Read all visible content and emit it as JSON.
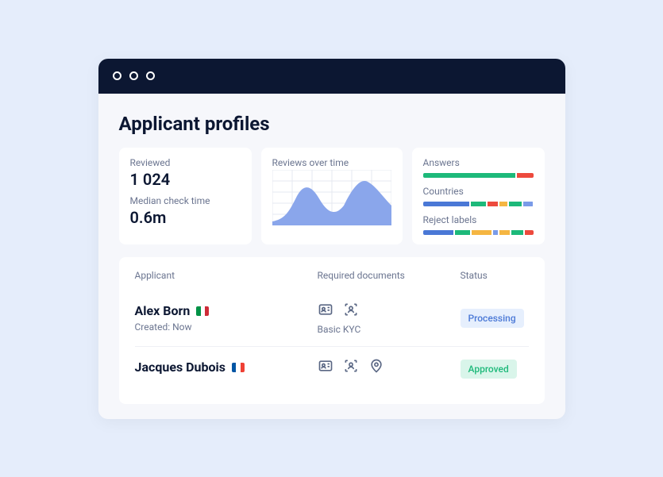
{
  "page_title": "Applicant profiles",
  "stats": {
    "reviewed_label": "Reviewed",
    "reviewed_value": "1 024",
    "median_label": "Median check time",
    "median_value": "0.6m"
  },
  "chart_title": "Reviews over time",
  "chart_data": {
    "type": "area",
    "title": "Reviews over time",
    "xlabel": "",
    "ylabel": "",
    "x": [
      0,
      1,
      2,
      3,
      4,
      5,
      6,
      7,
      8,
      9
    ],
    "values": [
      5,
      10,
      35,
      50,
      30,
      15,
      25,
      55,
      50,
      30
    ]
  },
  "bars": {
    "answers_label": "Answers",
    "answers_segments": [
      {
        "color": "#1db97a",
        "pct": 85
      },
      {
        "color": "#ed4a3d",
        "pct": 15
      }
    ],
    "countries_label": "Countries",
    "countries_segments": [
      {
        "color": "#4a78d6",
        "pct": 45
      },
      {
        "color": "#1db97a",
        "pct": 15
      },
      {
        "color": "#ed4a3d",
        "pct": 10
      },
      {
        "color": "#f5b642",
        "pct": 8
      },
      {
        "color": "#1db97a",
        "pct": 12
      },
      {
        "color": "#7a9be8",
        "pct": 10
      }
    ],
    "reject_label": "Reject labels",
    "reject_segments": [
      {
        "color": "#4a78d6",
        "pct": 30
      },
      {
        "color": "#1db97a",
        "pct": 15
      },
      {
        "color": "#f5b642",
        "pct": 20
      },
      {
        "color": "#7a9be8",
        "pct": 5
      },
      {
        "color": "#f5b642",
        "pct": 10
      },
      {
        "color": "#1db97a",
        "pct": 12
      },
      {
        "color": "#ed4a3d",
        "pct": 8
      }
    ]
  },
  "table": {
    "headers": {
      "applicant": "Applicant",
      "docs": "Required documents",
      "status": "Status"
    },
    "rows": [
      {
        "name": "Alex Born",
        "flag": [
          "#009246",
          "#ffffff",
          "#ce2b37"
        ],
        "created": "Created: Now",
        "docs_label": "Basic KYC",
        "icons": [
          "id-card",
          "face-scan"
        ],
        "status": "Processing",
        "status_class": "badge-processing"
      },
      {
        "name": "Jacques Dubois",
        "flag": [
          "#0055a4",
          "#ffffff",
          "#ef4135"
        ],
        "created": "",
        "docs_label": "",
        "icons": [
          "id-card",
          "face-scan",
          "location-pin"
        ],
        "status": "Approved",
        "status_class": "badge-approved"
      }
    ]
  }
}
